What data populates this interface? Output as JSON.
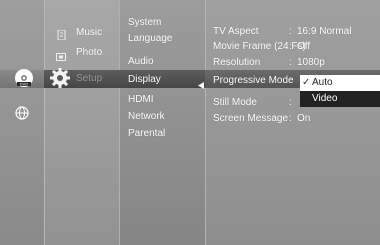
{
  "main_menu": {
    "items": [
      {
        "label": "Music"
      },
      {
        "label": "Photo"
      },
      {
        "label": "Setup"
      }
    ]
  },
  "setup_menu": {
    "items": [
      {
        "label": "System"
      },
      {
        "label": "Language"
      },
      {
        "label": "Audio"
      },
      {
        "label": "Display"
      },
      {
        "label": "HDMI"
      },
      {
        "label": "Network"
      },
      {
        "label": "Parental"
      }
    ]
  },
  "display_settings": {
    "rows": [
      {
        "label": "TV Aspect",
        "value": "16:9 Normal"
      },
      {
        "label": "Movie Frame (24 Fs)",
        "value": "Off"
      },
      {
        "label": "Resolution",
        "value": "1080p"
      },
      {
        "label": "Progressive Mode",
        "value": ""
      },
      {
        "label": "Still Mode",
        "value": ""
      },
      {
        "label": "Screen Message",
        "value": "On"
      }
    ],
    "colon": ":"
  },
  "progressive_popup": {
    "options": [
      {
        "label": "Auto",
        "selected": true,
        "check": "✓"
      },
      {
        "label": "Video",
        "selected": false
      }
    ]
  },
  "icons": {
    "disc": "dvd-disc-icon",
    "globe": "globe-icon",
    "music": "music-icon",
    "photo": "photo-icon",
    "setup": "gear-icon",
    "arrow": "left-arrow-icon"
  }
}
